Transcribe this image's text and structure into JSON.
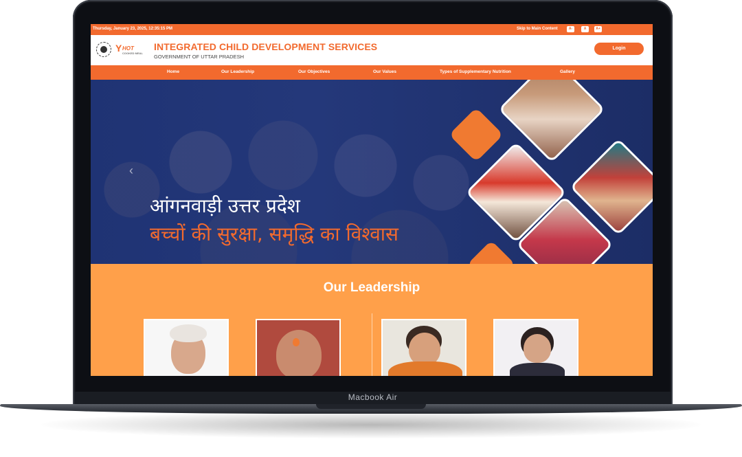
{
  "device": {
    "label": "Macbook Air"
  },
  "topbar": {
    "datetime": "Thursday, January 23, 2025, 12:35:15 PM",
    "skip_link": "Skip to Main Content",
    "font_buttons": [
      "A-",
      "A",
      "A+"
    ]
  },
  "header": {
    "logo_text": "HOT",
    "logo_subtext": "COOKED MEAL",
    "title": "INTEGRATED CHILD DEVELOPMENT SERVICES",
    "subtitle": "GOVERNMENT OF UTTAR PRADESH",
    "login_label": "Login"
  },
  "nav": {
    "items": [
      "Home",
      "Our Leadership",
      "Our Objectives",
      "Our Values",
      "Types of Supplementary Nutrition",
      "Gallery"
    ]
  },
  "hero": {
    "line1": "आंगनवाड़ी उत्तर प्रदेश",
    "line2": "बच्चों की सुरक्षा, समृद्धि का विश्वास",
    "prev_arrow": "‹",
    "colors": {
      "background": "#1f3374",
      "accent": "#f26a2e"
    }
  },
  "leadership": {
    "title": "Our Leadership",
    "background": "#ffa04a"
  },
  "colors": {
    "brand": "#f26a2e",
    "frame": "#0d0f14"
  }
}
